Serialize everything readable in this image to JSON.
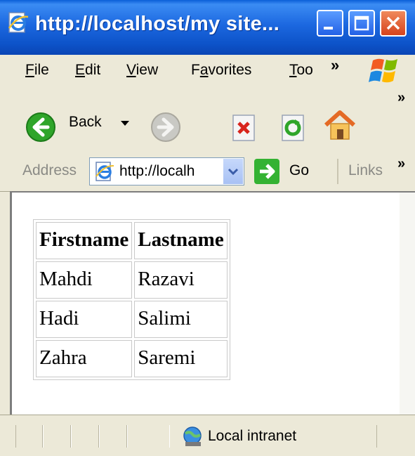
{
  "window": {
    "title": "http://localhost/my site...",
    "icon": "ie-page-icon",
    "buttons": [
      "minimize-icon",
      "maximize-icon",
      "close-icon"
    ]
  },
  "menubar": {
    "items": [
      {
        "label": "File",
        "accel": "F",
        "rest": "ile"
      },
      {
        "label": "Edit",
        "accel": "E",
        "rest": "dit"
      },
      {
        "label": "View",
        "accel": "V",
        "rest": "iew"
      },
      {
        "label": "Favorites",
        "pre": "F",
        "accel": "a",
        "rest": "vorites"
      },
      {
        "label": "Too",
        "accel": "T",
        "rest": "oo"
      }
    ],
    "overflow": "»"
  },
  "toolbar": {
    "back_label": "Back",
    "overflow": "»"
  },
  "address": {
    "label": "Address",
    "value": "http://localh",
    "go_label": "Go",
    "links_label": "Links",
    "overflow": "»"
  },
  "table": {
    "headers": [
      "Firstname",
      "Lastname"
    ],
    "rows": [
      [
        "Mahdi",
        "Razavi"
      ],
      [
        "Hadi",
        "Salimi"
      ],
      [
        "Zahra",
        "Saremi"
      ]
    ]
  },
  "status": {
    "zone": "Local intranet"
  },
  "colors": {
    "titlebar": "#1c68e0",
    "chrome": "#ece9d8",
    "go_green": "#34b233"
  }
}
